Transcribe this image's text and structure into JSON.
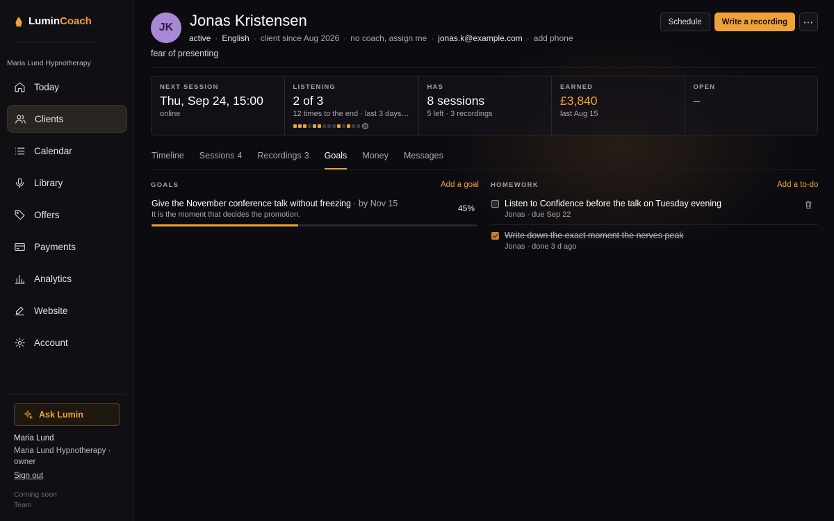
{
  "brand": {
    "part1": "Lumin",
    "part2": "Coach",
    "icon": "logo-drop-icon"
  },
  "sidebar": {
    "business": "Maria Lund Hypnotherapy",
    "items": [
      {
        "label": "Today",
        "icon": "home-icon"
      },
      {
        "label": "Clients",
        "icon": "users-icon",
        "active": true
      },
      {
        "label": "Calendar",
        "icon": "list-icon"
      },
      {
        "label": "Library",
        "icon": "microphone-icon"
      },
      {
        "label": "Offers",
        "icon": "tag-icon"
      },
      {
        "label": "Payments",
        "icon": "card-icon"
      },
      {
        "label": "Analytics",
        "icon": "bar-chart-icon"
      },
      {
        "label": "Website",
        "icon": "edit-icon"
      },
      {
        "label": "Account",
        "icon": "gear-icon"
      }
    ],
    "ask_label": "Ask Lumin",
    "user_name": "Maria Lund",
    "user_business": "Maria Lund Hypnotherapy · owner",
    "sign_out": "Sign out",
    "coming_soon": "Coming soon",
    "coming_soon_item": "Team"
  },
  "client": {
    "initials": "JK",
    "name": "Jonas Kristensen",
    "status": "active",
    "language": "English",
    "since": "client since Aug 2026",
    "coach": "no coach, assign me",
    "email": "jonas.k@example.com",
    "phone_link": "add phone",
    "subtitle": "fear of presenting"
  },
  "actions": {
    "schedule": "Schedule",
    "write_recording": "Write a recording",
    "more": "⋯"
  },
  "stats": {
    "next_session": {
      "label": "NEXT SESSION",
      "value": "Thu, Sep 24, 15:00",
      "sub": "online"
    },
    "listening": {
      "label": "LISTENING",
      "value": "2 of 3",
      "sub": "12 times to the end · last 3 days ago",
      "pips": [
        1,
        1,
        1,
        0,
        1,
        1,
        0,
        0,
        0,
        1,
        0,
        1,
        0,
        0
      ]
    },
    "has": {
      "label": "HAS",
      "value": "8 sessions",
      "sub": "5 left · 3 recordings"
    },
    "earned": {
      "label": "EARNED",
      "value": "£3,840",
      "sub": "last Aug 15"
    },
    "open": {
      "label": "OPEN",
      "value": "–"
    }
  },
  "tabs": [
    {
      "label": "Timeline",
      "count": ""
    },
    {
      "label": "Sessions",
      "count": "4"
    },
    {
      "label": "Recordings",
      "count": "3"
    },
    {
      "label": "Goals",
      "count": "",
      "active": true
    },
    {
      "label": "Money",
      "count": ""
    },
    {
      "label": "Messages",
      "count": ""
    }
  ],
  "goals": {
    "title": "GOALS",
    "add": "Add a goal",
    "item": {
      "title": "Give the November conference talk without freezing",
      "by": " · by Nov 15",
      "desc": "It is the moment that decides the promotion.",
      "pct_label": "45%",
      "progress": 0.45
    }
  },
  "homework": {
    "title": "HOMEWORK",
    "add": "Add a to-do",
    "items": [
      {
        "title": "Listen to Confidence before the talk on Tuesday evening",
        "sub": "Jonas · due Sep 22",
        "done": false
      },
      {
        "title": "Write down the exact moment the nerves peak",
        "sub": "Jonas · done 3 d ago",
        "done": true
      }
    ]
  },
  "colors": {
    "accent": "#f0a23a",
    "background": "#0c0b10",
    "avatar": "#a889d6"
  }
}
